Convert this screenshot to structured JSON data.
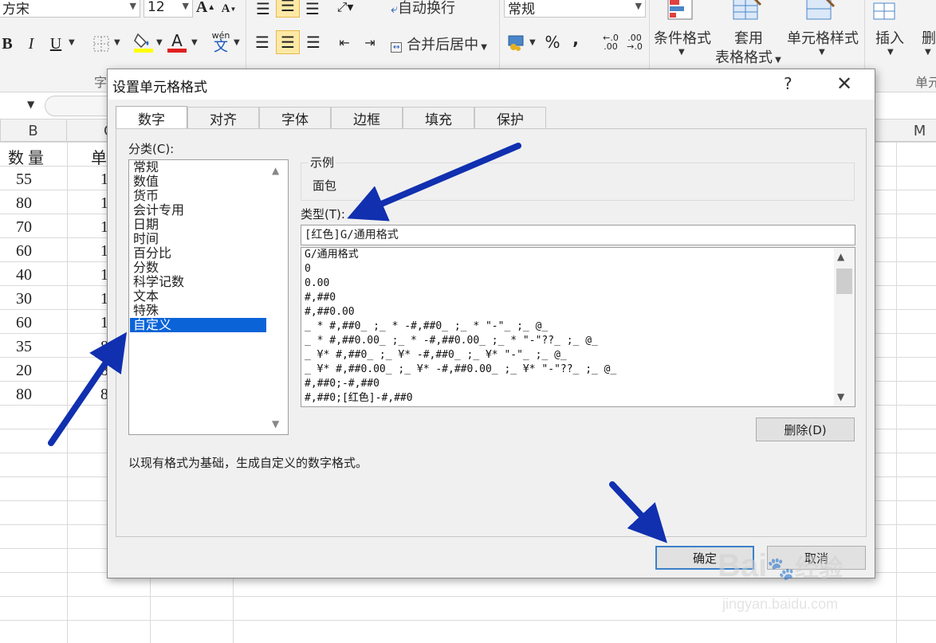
{
  "ribbon": {
    "font_name": "方宋",
    "font_size": "12",
    "grow_font": "A",
    "shrink_font": "A",
    "bold": "B",
    "italic": "I",
    "underline": "U",
    "font_color_letter": "A",
    "phonetic": "wén",
    "phonetic_char": "文",
    "wrap_text": "自动换行",
    "merge_center": "合并后居中",
    "number_format": "常规",
    "percent": "%",
    "comma": ",",
    "conditional_format": "条件格式",
    "table_format_1": "套用",
    "table_format_2": "表格格式",
    "cell_styles": "单元格样式",
    "insert": "插入",
    "delete_partial": "删",
    "group_font_partial": "字",
    "group_cells_partial": "单元",
    "accent_font_color": "#e02020",
    "accent_fill_color": "#ffff00"
  },
  "sheet": {
    "columns": [
      "B",
      "C",
      "M"
    ],
    "header_row": [
      "数 量",
      "单"
    ],
    "qty_values": [
      "55",
      "80",
      "70",
      "60",
      "40",
      "30",
      "60",
      "35",
      "20",
      "80"
    ],
    "c_values": [
      "1",
      "1",
      "1",
      "1",
      "1",
      "1",
      "1",
      "8",
      "8",
      "8"
    ]
  },
  "dialog": {
    "title": "设置单元格格式",
    "help": "?",
    "close": "✕",
    "tabs": [
      "数字",
      "对齐",
      "字体",
      "边框",
      "填充",
      "保护"
    ],
    "active_tab": "数字",
    "category_label": "分类(C):",
    "categories": [
      "常规",
      "数值",
      "货币",
      "会计专用",
      "日期",
      "时间",
      "百分比",
      "分数",
      "科学记数",
      "文本",
      "特殊",
      "自定义"
    ],
    "selected_category": "自定义",
    "sample_label": "示例",
    "sample_value": "面包",
    "type_label": "类型(T):",
    "type_value": "[红色]G/通用格式",
    "format_list": [
      "G/通用格式",
      "0",
      "0.00",
      "#,##0",
      "#,##0.00",
      "_ * #,##0_ ;_ * -#,##0_ ;_ * \"-\"_ ;_ @_",
      "_ * #,##0.00_ ;_ * -#,##0.00_ ;_ * \"-\"??_ ;_ @_",
      "_ ¥* #,##0_ ;_ ¥* -#,##0_ ;_ ¥* \"-\"_ ;_ @_",
      "_ ¥* #,##0.00_ ;_ ¥* -#,##0.00_ ;_ ¥* \"-\"??_ ;_ @_",
      "#,##0;-#,##0",
      "#,##0;[红色]-#,##0"
    ],
    "delete_button": "删除(D)",
    "description": "以现有格式为基础，生成自定义的数字格式。",
    "ok_button": "确定",
    "cancel_button": "取消"
  },
  "watermark": {
    "line1": "Bai",
    "line1b": "经验",
    "line2": "jingyan.baidu.com"
  },
  "annotation_color": "#1030b0"
}
